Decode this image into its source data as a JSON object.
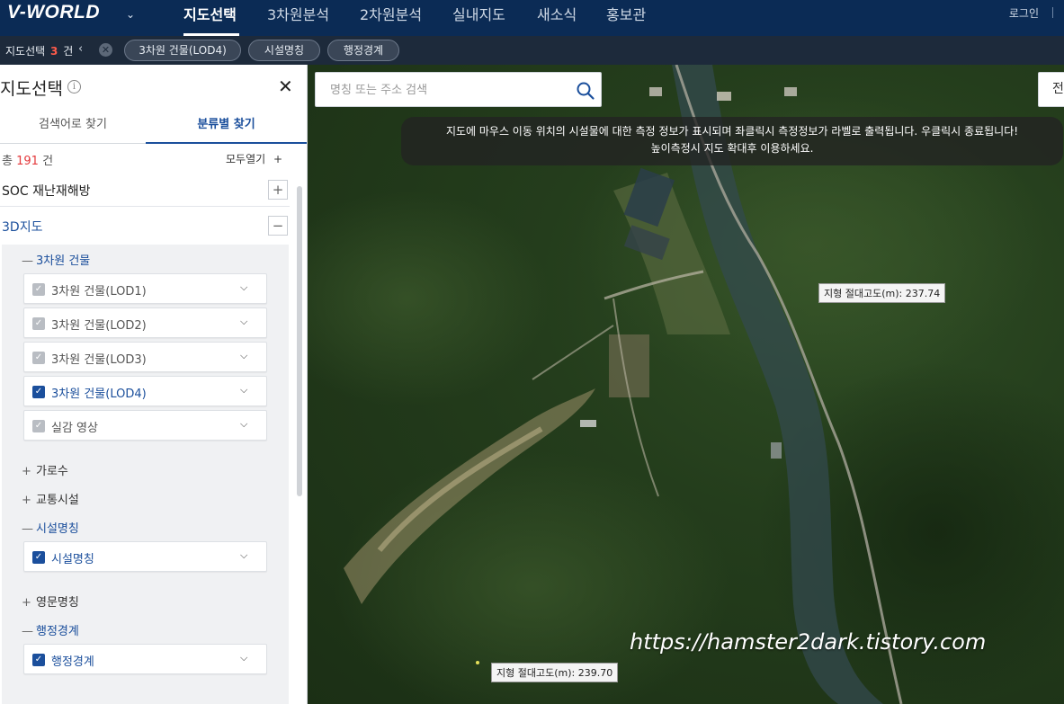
{
  "brand": {
    "logo": "V-WORLD",
    "dropdown_icon": "chevron-down-icon"
  },
  "nav": {
    "items": [
      {
        "label": "지도선택",
        "active": true
      },
      {
        "label": "3차원분석",
        "active": false
      },
      {
        "label": "2차원분석",
        "active": false
      },
      {
        "label": "실내지도",
        "active": false
      },
      {
        "label": "새소식",
        "active": false
      },
      {
        "label": "홍보관",
        "active": false
      }
    ],
    "login": "로그인"
  },
  "filter_bar": {
    "label": "지도선택",
    "count": "3",
    "unit": "건",
    "chips": [
      "3차원 건물(LOD4)",
      "시설명칭",
      "행정경계"
    ]
  },
  "sidebar": {
    "title": "지도선택",
    "tabs": [
      {
        "label": "검색어로 찾기",
        "active": false
      },
      {
        "label": "분류별 찾기",
        "active": true
      }
    ],
    "total_prefix": "총",
    "total_count": "191",
    "total_unit": "건",
    "expand_all": "모두열기",
    "categories": [
      {
        "label": "SOC 재난재해방",
        "expanded": false
      },
      {
        "label": "3D지도",
        "expanded": true
      }
    ],
    "groups": {
      "building": {
        "label": "3차원 건물",
        "items": [
          {
            "label": "3차원 건물(LOD1)",
            "checked": false
          },
          {
            "label": "3차원 건물(LOD2)",
            "checked": false
          },
          {
            "label": "3차원 건물(LOD3)",
            "checked": false
          },
          {
            "label": "3차원 건물(LOD4)",
            "checked": true
          },
          {
            "label": "실감 영상",
            "checked": false
          }
        ]
      },
      "street_trees": {
        "label": "가로수"
      },
      "transport": {
        "label": "교통시설"
      },
      "facility": {
        "label": "시설명칭",
        "items": [
          {
            "label": "시설명칭",
            "checked": true
          }
        ]
      },
      "english": {
        "label": "영문명칭"
      },
      "admin": {
        "label": "행정경계",
        "items": [
          {
            "label": "행정경계",
            "checked": true
          }
        ]
      }
    }
  },
  "map": {
    "search_placeholder": "명칭 또는 주소 검색",
    "search2_label": "전",
    "notice_line1": "지도에 마우스 이동 위치의 시설물에 대한 측정 정보가 표시되며 좌클릭시 측정정보가 라벨로 출력됩니다. 우클릭시 종료됩니다!",
    "notice_line2": "높이측정시 지도 확대후 이용하세요.",
    "labels": [
      "지형 절대고도(m): 237.74",
      "지형 절대고도(m): 239.70"
    ],
    "watermark": "https://hamster2dark.tistory.com"
  },
  "colors": {
    "nav_bg": "#0b2b55",
    "filter_bg": "#1d2a3b",
    "accent": "#1b4f9c",
    "count_red": "#e4393c"
  }
}
